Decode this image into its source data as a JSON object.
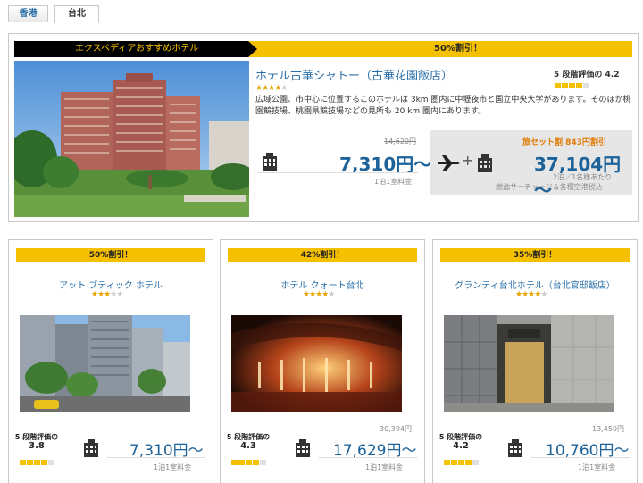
{
  "tabs": [
    {
      "label": "香港"
    },
    {
      "label": "台北"
    }
  ],
  "featured": {
    "banner_left": "エクスペディアおすすめホテル",
    "banner_right": "50%割引！",
    "name": "ホテル古華シャトー（古華花園飯店）",
    "stars": 4,
    "rating_label": "5 段階評価の",
    "rating": "4.2",
    "rating_fill": 4.2,
    "description": "広域公園、市中心に位置するこのホテルは 3km 圏内に中壢夜市と国立中央大学があります。そのほか桃園競技場、桃園県競技場などの見所も 20 km 圏内にあります。",
    "old_price": "14,620円",
    "price": "7,310円～",
    "price_note": "1泊1室料金",
    "package": {
      "label": "旅セット割 843円割引",
      "price": "37,104円～",
      "note1": "2泊／1名様あたり",
      "note2": "燃油サーチャージ＆各種空港税込"
    }
  },
  "cards": [
    {
      "banner": "50%割引！",
      "name": "アット ブティック ホテル",
      "stars": 3,
      "rating_label": "5 段階評価の",
      "rating": "3.8",
      "rating_fill": 3.8,
      "old_price": "",
      "price": "7,310円～",
      "price_note": "1泊1室料金"
    },
    {
      "banner": "42%割引！",
      "name": "ホテル クォート台北",
      "stars": 4,
      "rating_label": "5 段階評価の",
      "rating": "4.3",
      "rating_fill": 4.3,
      "old_price": "30,394円",
      "price": "17,629円～",
      "price_note": "1泊1室料金"
    },
    {
      "banner": "35%割引！",
      "name": "グランティ台北ホテル（台北官邸飯店）",
      "stars": 4,
      "rating_label": "5 段階評価の",
      "rating": "4.2",
      "rating_fill": 4.2,
      "old_price": "13,450円",
      "price": "10,760円～",
      "price_note": "1泊1室料金"
    }
  ],
  "colors": {
    "accent": "#f5c000",
    "price": "#1d6298",
    "link": "#2a6fa8"
  },
  "icons": [
    "hotel-icon",
    "plane-icon",
    "plus-icon",
    "star-icon"
  ]
}
